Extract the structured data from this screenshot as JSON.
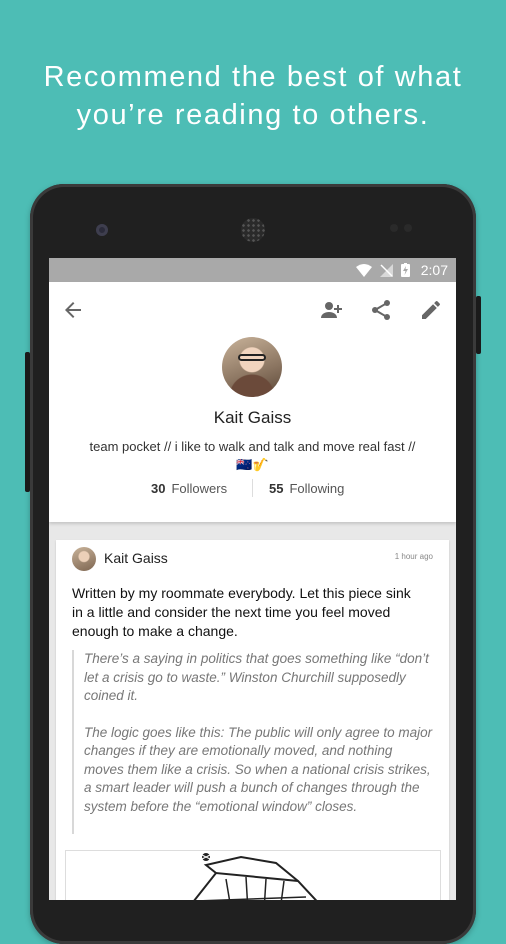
{
  "promo": {
    "headline_line1": "Recommend the best of what",
    "headline_line2": "you’re reading to others."
  },
  "statusbar": {
    "time": "2:07"
  },
  "profile": {
    "name": "Kait Gaiss",
    "bio": "team pocket // i like to walk and talk and move real fast // 🇳🇿🎷",
    "followers_count": "30",
    "followers_label": "Followers",
    "following_count": "55",
    "following_label": "Following"
  },
  "post": {
    "author": "Kait Gaiss",
    "time": "1 hour ago",
    "body": "Written by my roommate everybody. Let this piece sink in a little and consider the next time you feel moved enough to make a change.",
    "quote_p1": "There’s a saying in politics that goes something like “don’t let a crisis go to waste.” Winston Churchill supposedly coined it.",
    "quote_p2": "The logic goes like this: The public will only agree to major changes if they are emotionally moved, and nothing moves them like a crisis. So when a national crisis strikes, a smart leader will push a bunch of changes through the system before the “emotional window” closes."
  },
  "colors": {
    "background": "#4dbdb5",
    "statusbar": "#a9a9a9",
    "card": "#ffffff"
  },
  "icons": [
    "back-arrow-icon",
    "add-person-icon",
    "share-icon",
    "edit-pencil-icon",
    "wifi-icon",
    "no-signal-icon",
    "battery-charging-icon"
  ]
}
